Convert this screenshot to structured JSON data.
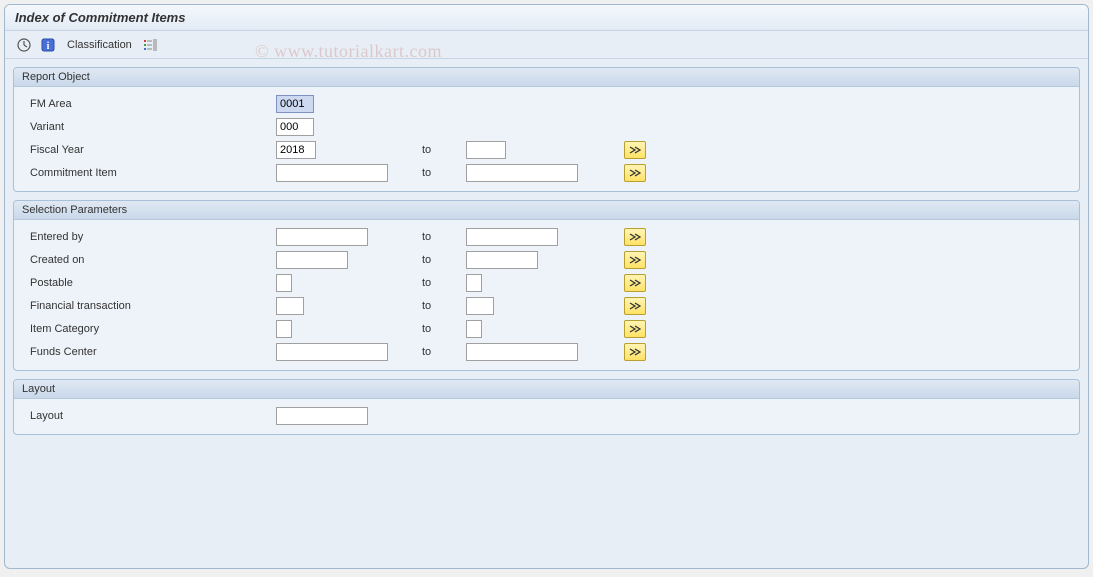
{
  "title": "Index of Commitment Items",
  "toolbar": {
    "classification_label": "Classification"
  },
  "watermark": "© www.tutorialkart.com",
  "groups": {
    "report_object": {
      "title": "Report Object",
      "fields": {
        "fm_area": {
          "label": "FM Area",
          "value": "0001"
        },
        "variant": {
          "label": "Variant",
          "value": "000"
        },
        "fiscal_year": {
          "label": "Fiscal Year",
          "from": "2018",
          "to_label": "to",
          "to": ""
        },
        "commitment_item": {
          "label": "Commitment Item",
          "from": "",
          "to_label": "to",
          "to": ""
        }
      }
    },
    "selection_params": {
      "title": "Selection Parameters",
      "fields": {
        "entered_by": {
          "label": "Entered by",
          "from": "",
          "to_label": "to",
          "to": ""
        },
        "created_on": {
          "label": "Created on",
          "from": "",
          "to_label": "to",
          "to": ""
        },
        "postable": {
          "label": "Postable",
          "from": "",
          "to_label": "to",
          "to": ""
        },
        "financial_trans": {
          "label": "Financial transaction",
          "from": "",
          "to_label": "to",
          "to": ""
        },
        "item_category": {
          "label": "Item Category",
          "from": "",
          "to_label": "to",
          "to": ""
        },
        "funds_center": {
          "label": "Funds Center",
          "from": "",
          "to_label": "to",
          "to": ""
        }
      }
    },
    "layout": {
      "title": "Layout",
      "fields": {
        "layout": {
          "label": "Layout",
          "value": ""
        }
      }
    }
  }
}
